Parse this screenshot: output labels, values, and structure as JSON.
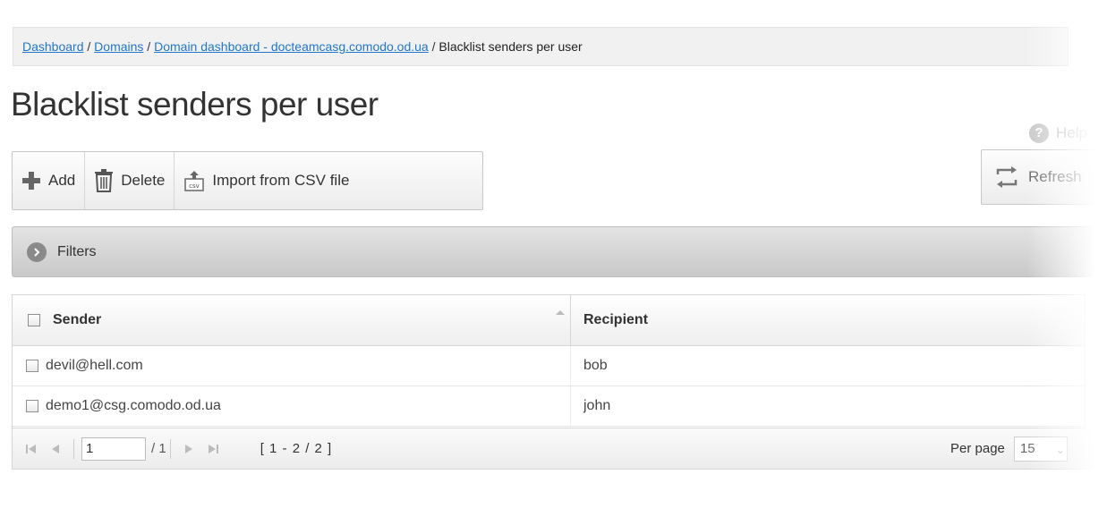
{
  "breadcrumb": {
    "items": [
      "Dashboard",
      "Domains",
      "Domain dashboard - docteamcasg.comodo.od.ua"
    ],
    "separator": " / ",
    "current": "Blacklist senders per user"
  },
  "page_title": "Blacklist senders per user",
  "help_label": "Help",
  "toolbar": {
    "add_label": "Add",
    "delete_label": "Delete",
    "import_label": "Import from CSV file",
    "refresh_label": "Refresh"
  },
  "filters_label": "Filters",
  "table": {
    "columns": [
      "Sender",
      "Recipient"
    ],
    "rows": [
      {
        "sender": "devil@hell.com",
        "recipient": "bob"
      },
      {
        "sender": "demo1@csg.comodo.od.ua",
        "recipient": "john"
      }
    ]
  },
  "pager": {
    "page": "1",
    "total": "/ 1",
    "range": "[ 1 - 2 / 2 ]",
    "per_page_label": "Per page",
    "per_page_value": "15"
  },
  "icons": [
    "plus-icon",
    "trash-icon",
    "csv-import-icon",
    "refresh-icon",
    "help-icon",
    "chevron-right-icon",
    "first-page-icon",
    "prev-page-icon",
    "next-page-icon",
    "last-page-icon"
  ]
}
